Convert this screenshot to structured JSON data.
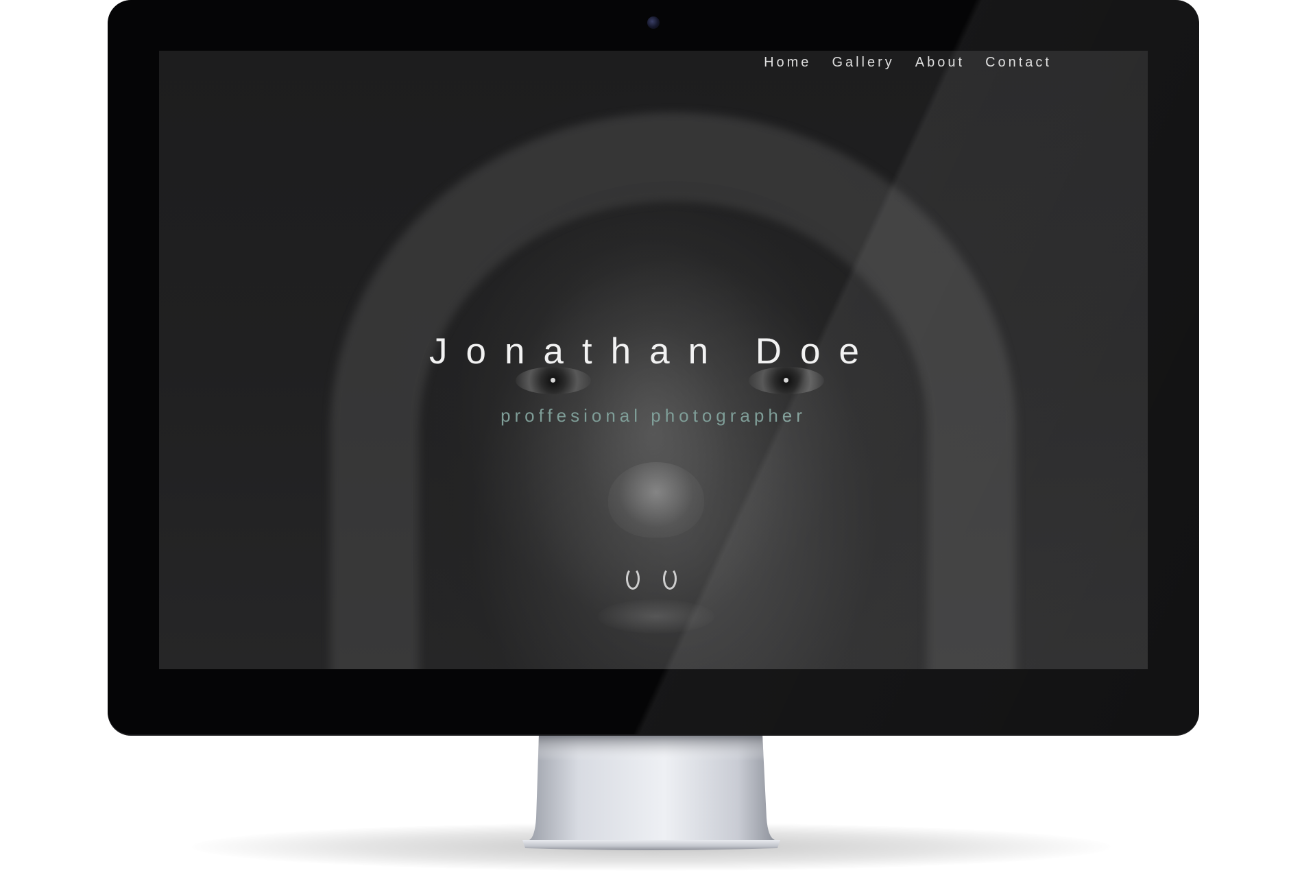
{
  "nav": {
    "items": [
      {
        "label": "Home"
      },
      {
        "label": "Gallery"
      },
      {
        "label": "About"
      },
      {
        "label": "Contact"
      }
    ]
  },
  "hero": {
    "title": "Jonathan Doe",
    "subtitle": "proffesional photographer"
  },
  "colors": {
    "bezel": "#050506",
    "screen_bg": "#1c1c1d",
    "title_text": "#f2f2f2",
    "subtitle_accent": "#7f9e98",
    "nav_text": "#dedede",
    "stand_silver": "#c4c7cf"
  },
  "icons": {
    "camera": "webcam-icon"
  }
}
